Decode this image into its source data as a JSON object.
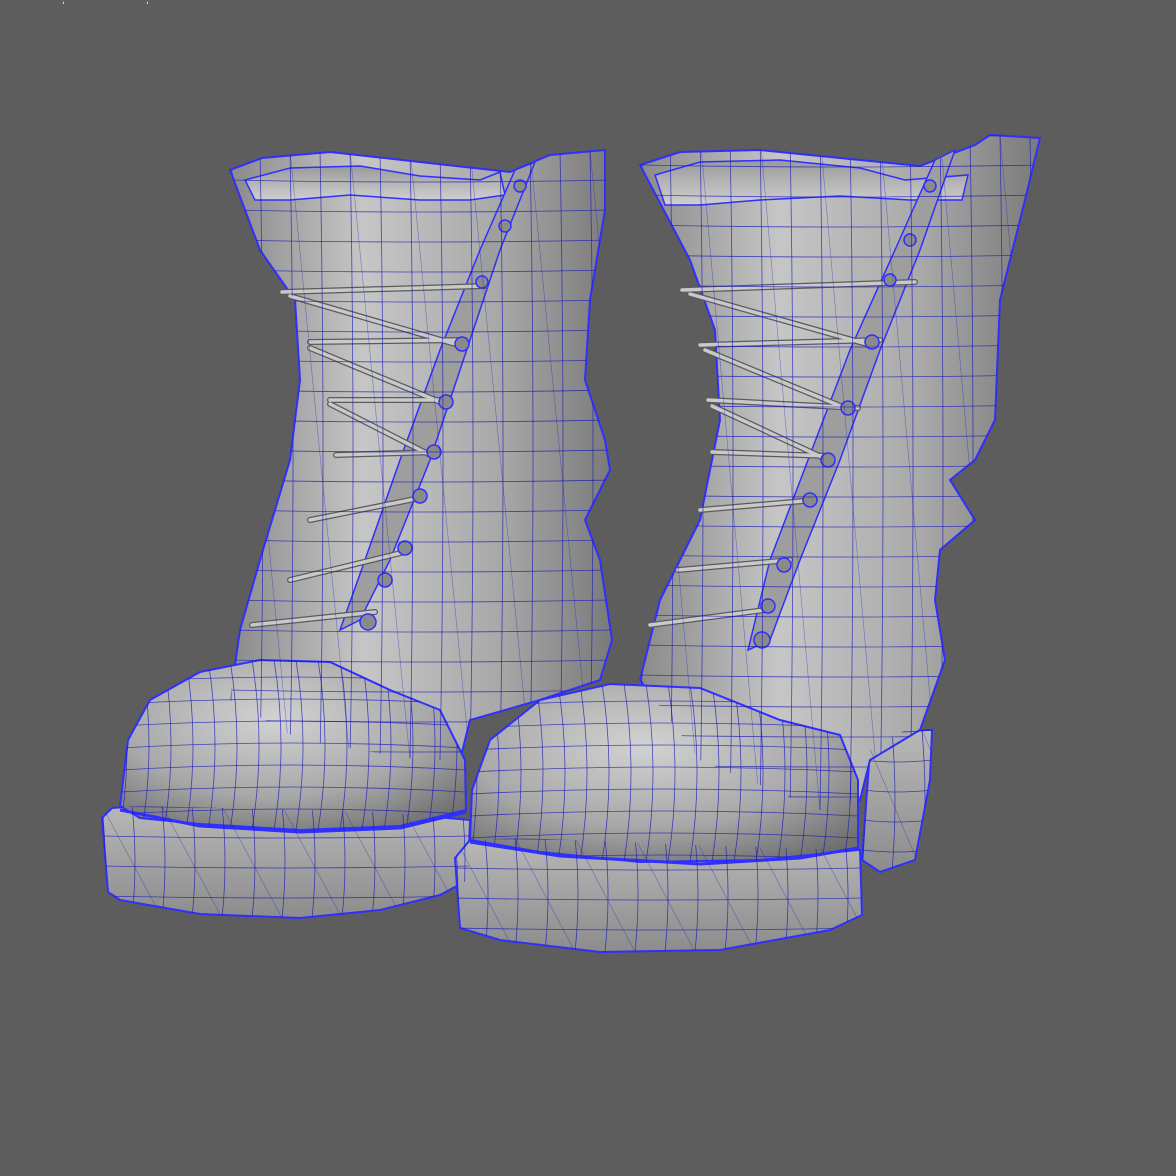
{
  "viewport": {
    "background_color": "#5d5d5d",
    "wireframe_color": "#2f2fff",
    "edge_color": "#1a1ab8",
    "mesh_fill_light": "#c4c4c4",
    "mesh_fill_mid": "#9c9c9c",
    "mesh_fill_dark": "#6e6e6e",
    "display_mode": "wireframe-on-shaded"
  },
  "models": [
    {
      "name": "left-boot"
    },
    {
      "name": "right-boot"
    }
  ]
}
